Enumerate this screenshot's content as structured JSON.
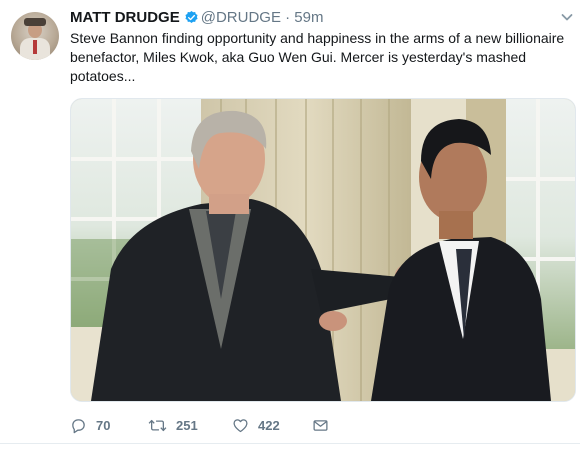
{
  "tweet": {
    "display_name": "MATT DRUDGE",
    "handle": "@DRUDGE",
    "separator": "·",
    "time": "59m",
    "text": "Steve Bannon finding opportunity and happiness in the arms of a new billionaire benefactor, Miles Kwok, aka Guo Wen Gui.  Mercer is yesterday's mashed potatoes...",
    "verified_color": "#1da1f2",
    "icons": {
      "avatar": "profile-photo",
      "verified": "verified-badge-icon",
      "caret": "chevron-down-icon",
      "reply": "reply-icon",
      "retweet": "retweet-icon",
      "like": "heart-icon",
      "dm": "direct-message-icon"
    },
    "stats": {
      "replies": "70",
      "retweets": "251",
      "likes": "422"
    }
  }
}
